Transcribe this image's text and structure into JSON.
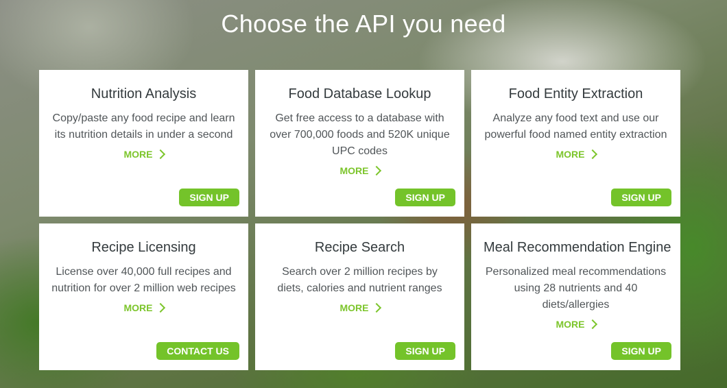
{
  "header": {
    "title": "Choose the API you need"
  },
  "cards": [
    {
      "title": "Nutrition Analysis",
      "description": "Copy/paste any food recipe and learn its nutrition details in under a second",
      "more_label": "MORE",
      "button_label": "SIGN UP"
    },
    {
      "title": "Food Database Lookup",
      "description": "Get free access to a database with over 700,000 foods and 520K unique UPC codes",
      "more_label": "MORE",
      "button_label": "SIGN UP"
    },
    {
      "title": "Food Entity Extraction",
      "description": "Analyze any food text and use our powerful food named entity extraction",
      "more_label": "MORE",
      "button_label": "SIGN UP"
    },
    {
      "title": "Recipe Licensing",
      "description": "License over 40,000 full recipes and nutrition for over 2 million web recipes",
      "more_label": "MORE",
      "button_label": "CONTACT US"
    },
    {
      "title": "Recipe Search",
      "description": "Search over 2 million recipes by diets, calories and nutrient ranges",
      "more_label": "MORE",
      "button_label": "SIGN UP"
    },
    {
      "title": "Meal Recommendation Engine",
      "description": "Personalized meal recommendations using 28 nutrients and 40 diets/allergies",
      "more_label": "MORE",
      "button_label": "SIGN UP"
    }
  ],
  "icons": {
    "more": "chevron-right-icon"
  },
  "colors": {
    "accent": "#74c32a",
    "link": "#7cc52b",
    "card_background": "#ffffff",
    "title_text": "#333a3d",
    "body_text": "#505558"
  }
}
